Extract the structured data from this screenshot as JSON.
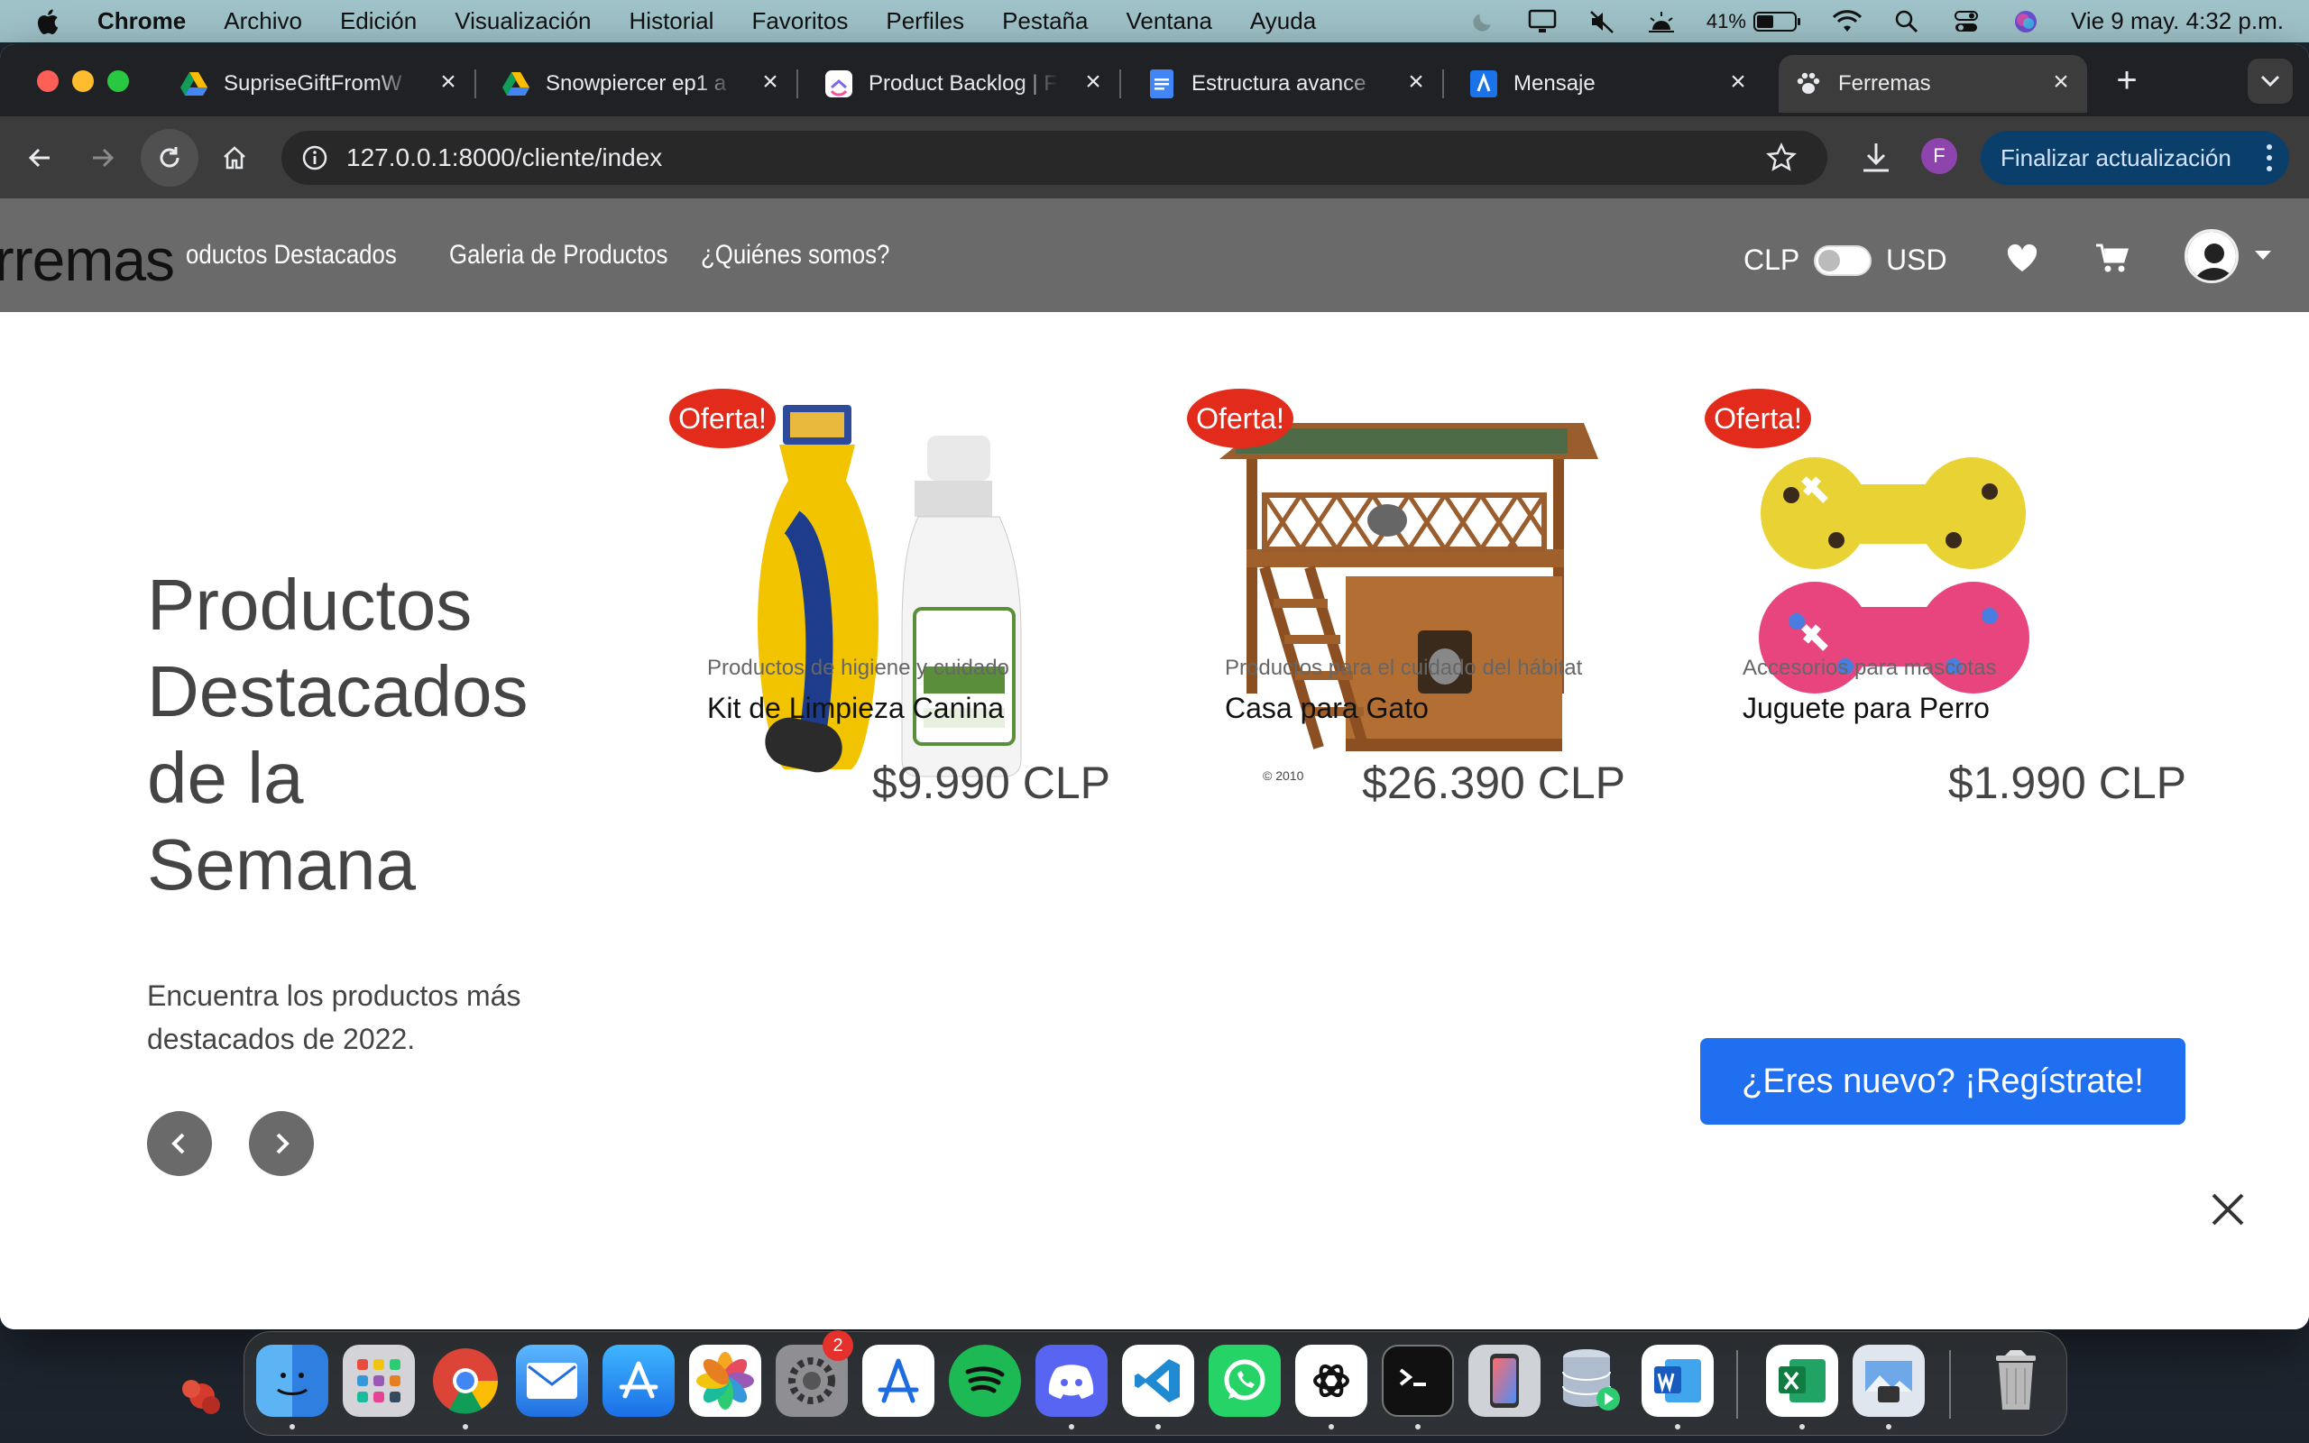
{
  "menubar": {
    "app_name": "Chrome",
    "items": [
      "Archivo",
      "Edición",
      "Visualización",
      "Historial",
      "Favoritos",
      "Perfiles",
      "Pestaña",
      "Ventana",
      "Ayuda"
    ],
    "battery": "41%",
    "clock": "Vie 9 may.  4:32 p.m."
  },
  "browser": {
    "tabs": [
      {
        "title": "SupriseGiftFromW",
        "icon": "google-drive-icon"
      },
      {
        "title": "Snowpiercer ep1 a",
        "icon": "google-drive-icon"
      },
      {
        "title": "Product Backlog | F",
        "icon": "clickup-icon"
      },
      {
        "title": "Estructura avance ",
        "icon": "google-docs-icon"
      },
      {
        "title": "Mensaje",
        "icon": "app-icon"
      },
      {
        "title": "Ferremas",
        "icon": "paw-icon",
        "active": true
      }
    ],
    "url": "127.0.0.1:8000/cliente/index",
    "profile_initial": "F",
    "update_label": "Finalizar actualización"
  },
  "site": {
    "brand": "erremas",
    "nav_links": [
      "oductos Destacados",
      "Galeria de Productos",
      "¿Quiénes somos?"
    ],
    "currency_left": "CLP",
    "currency_right": "USD",
    "currency_toggle_usd": false
  },
  "hero": {
    "title": "Productos Destacados de la Semana",
    "subtitle": "Encuentra los productos más destacados de 2022."
  },
  "products": [
    {
      "badge": "Oferta!",
      "category": "Productos de higiene y cuidado",
      "name": "Kit de Limpieza Canina",
      "price": "$9.990 CLP"
    },
    {
      "badge": "Oferta!",
      "category": "Productos para el cuidado del hábitat",
      "name": "Casa para Gato",
      "price": "$26.390 CLP"
    },
    {
      "badge": "Oferta!",
      "category": "Accesorios para mascotas",
      "name": "Juguete para Perro",
      "price": "$1.990 CLP"
    }
  ],
  "register_prompt": "¿Eres nuevo? ¡Regístrate!",
  "image_credit": "© 2010",
  "dock": {
    "apps": [
      "finder-icon",
      "launchpad-icon",
      "chrome-icon",
      "mail-icon",
      "app-store-icon",
      "photos-icon",
      "system-settings-icon",
      "instruments-icon",
      "spotify-icon",
      "discord-icon",
      "vscode-icon",
      "whatsapp-icon",
      "chatgpt-icon",
      "terminal-icon",
      "simulator-icon",
      "database-icon",
      "word-icon",
      "excel-icon",
      "preview-icon",
      "trash-icon"
    ],
    "settings_badge": "2"
  },
  "colors": {
    "menubar": "#9fc3c9",
    "site_nav": "#6b6a6a",
    "offer_badge": "#e32b1c",
    "register_button": "#1f6ff0",
    "chrome_dark": "#202124"
  }
}
